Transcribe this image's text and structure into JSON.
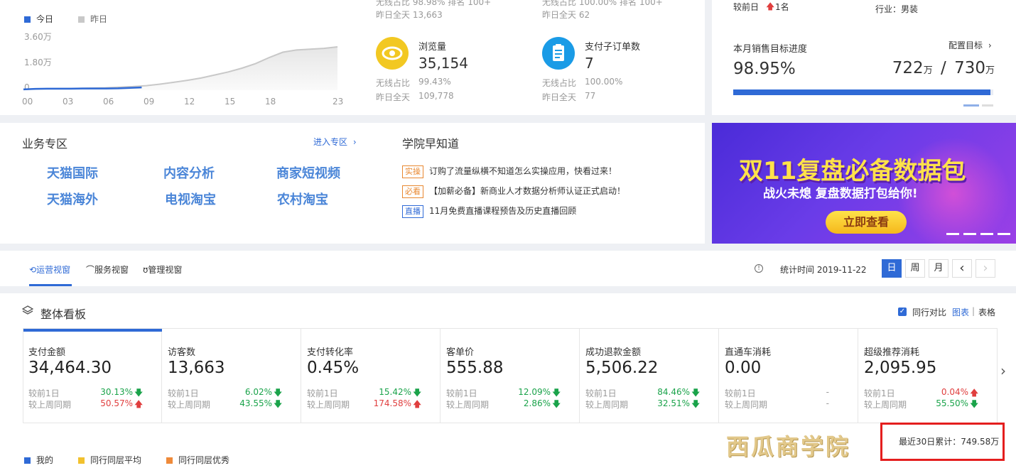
{
  "top_chart": {
    "legend_today": "今日",
    "legend_yesterday": "昨日",
    "y_ticks": [
      "3.60万",
      "1.80万",
      "0"
    ],
    "x_ticks": [
      "00",
      "03",
      "06",
      "09",
      "12",
      "15",
      "18",
      "23"
    ],
    "colors": {
      "today": "#2f6ad6",
      "yesterday": "#c8c8c8"
    }
  },
  "chart_data": {
    "type": "area",
    "x": [
      0,
      1,
      2,
      3,
      4,
      5,
      6,
      7,
      8,
      9,
      10,
      11,
      12,
      13,
      14,
      15,
      16,
      17,
      18,
      19,
      20,
      21,
      22,
      23
    ],
    "ylim": [
      0,
      36000
    ],
    "series": [
      {
        "name": "今日",
        "values": [
          500,
          900,
          1000,
          1000,
          1000,
          1100,
          1100,
          1100,
          1200,
          1500,
          1800
        ]
      },
      {
        "name": "昨日",
        "values": [
          500,
          900,
          1000,
          1100,
          1200,
          1400,
          1600,
          2000,
          2400,
          3000,
          4000,
          5200,
          6500,
          8000,
          10000,
          12000,
          14500,
          17500,
          21500,
          25000,
          26500,
          27000,
          27500,
          28500
        ]
      }
    ]
  },
  "stats_top": {
    "col1_clipped": [
      "无线占比 98.98%  排名 100+",
      "昨日全天 13,663"
    ],
    "col2_clipped": [
      "无线占比 100.00% 排名 100+",
      "昨日全天 62"
    ],
    "pv": {
      "label": "浏览量",
      "value": "35,154",
      "wireless_label": "无线占比",
      "wireless": "99.43%",
      "yday_label": "昨日全天",
      "yday": "109,778"
    },
    "orders": {
      "label": "支付子订单数",
      "value": "7",
      "wireless_label": "无线占比",
      "wireless": "100.00%",
      "yday_label": "昨日全天",
      "yday": "77"
    }
  },
  "right_panel": {
    "compare_label": "较前日",
    "rank_change": "1名",
    "industry": "行业：男装",
    "target_title": "本月销售目标进度",
    "config_link": "配置目标",
    "percent": "98.95%",
    "current": "722",
    "target": "730",
    "unit": "万",
    "separator": "/",
    "progress": 0.9895
  },
  "business": {
    "title": "业务专区",
    "enter_link": "进入专区",
    "links": [
      "天猫国际",
      "内容分析",
      "商家短视频",
      "天猫海外",
      "电视淘宝",
      "农村淘宝"
    ]
  },
  "academy": {
    "title": "学院早知道",
    "items": [
      {
        "tag": "实操",
        "text": "订购了流量纵横不知道怎么实操应用，快看过来！",
        "tag_color": "#e8872f"
      },
      {
        "tag": "必看",
        "text": "【加薪必备】新商业人才数据分析师认证正式启动！",
        "tag_color": "#e8872f"
      },
      {
        "tag": "直播",
        "text": "11月免费直播课程预告及历史直播回顾",
        "tag_color": "#2f6ad6"
      }
    ]
  },
  "banner": {
    "title": "双11复盘必备数据包",
    "subtitle": "战火未熄 复盘数据打包给你!",
    "button": "立即查看"
  },
  "view_tabs": {
    "tabs": [
      "运营视窗",
      "服务视窗",
      "管理视窗"
    ],
    "stat_time_label": "统计时间 2019-11-22",
    "period_buttons": [
      "日",
      "周",
      "月"
    ],
    "prev": "‹",
    "next": "›"
  },
  "dashboard": {
    "title": "整体看板",
    "peer_compare": "同行对比",
    "view_chart": "图表",
    "view_sep": "|",
    "view_table": "表格",
    "row1_label": "较前1日",
    "row2_label": "较上周同期",
    "kpis": [
      {
        "title": "支付金额",
        "value": "34,464.30",
        "p1": "30.13%",
        "d1": "down",
        "p2": "50.57%",
        "d2": "up"
      },
      {
        "title": "访客数",
        "value": "13,663",
        "p1": "6.02%",
        "d1": "down",
        "p2": "43.55%",
        "d2": "down"
      },
      {
        "title": "支付转化率",
        "value": "0.45%",
        "p1": "15.42%",
        "d1": "down",
        "p2": "174.58%",
        "d2": "up"
      },
      {
        "title": "客单价",
        "value": "555.88",
        "p1": "12.09%",
        "d1": "down",
        "p2": "2.86%",
        "d2": "down"
      },
      {
        "title": "成功退款金额",
        "value": "5,506.22",
        "p1": "84.46%",
        "d1": "down",
        "p2": "32.51%",
        "d2": "down"
      },
      {
        "title": "直通车消耗",
        "value": "0.00",
        "p1": "-",
        "d1": "none",
        "p2": "-",
        "d2": "none"
      },
      {
        "title": "超级推荐消耗",
        "value": "2,095.95",
        "p1": "0.04%",
        "d1": "up",
        "p2": "55.50%",
        "d2": "down"
      }
    ],
    "cumulative": "最近30日累计：749.58万",
    "legend": [
      "我的",
      "同行同层平均",
      "同行同层优秀"
    ],
    "legend_colors": [
      "#2f6ad6",
      "#f2c12e",
      "#ef8a3a"
    ]
  },
  "watermark": "西瓜商学院"
}
